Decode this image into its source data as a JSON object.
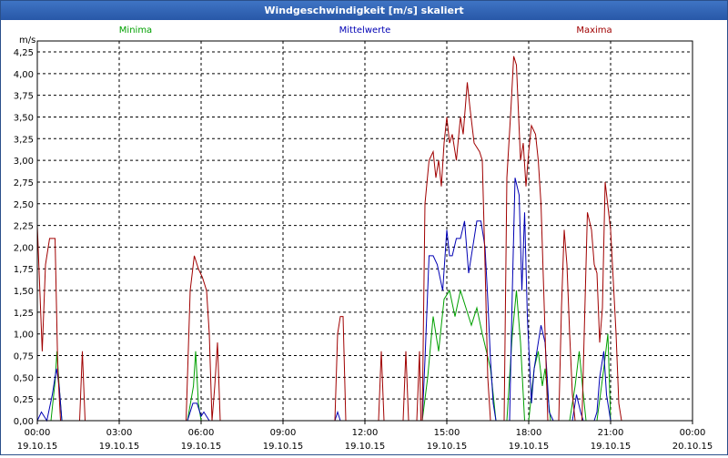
{
  "window": {
    "title": "Windgeschwindigkeit [m/s] skaliert"
  },
  "chart_data": {
    "type": "line",
    "ylabel": "m/s",
    "ylim": [
      0,
      4.25
    ],
    "yticks": [
      "0,00",
      "0,25",
      "0,50",
      "0,75",
      "1,00",
      "1,25",
      "1,50",
      "1,75",
      "2,00",
      "2,25",
      "2,50",
      "2,75",
      "3,00",
      "3,25",
      "3,50",
      "3,75",
      "4,00",
      "4,25"
    ],
    "xlim": [
      0,
      24
    ],
    "xticks": [
      {
        "time": "00:00",
        "date": "19.10.15"
      },
      {
        "time": "03:00",
        "date": "19.10.15"
      },
      {
        "time": "06:00",
        "date": "19.10.15"
      },
      {
        "time": "09:00",
        "date": "19.10.15"
      },
      {
        "time": "12:00",
        "date": "19.10.15"
      },
      {
        "time": "15:00",
        "date": "19.10.15"
      },
      {
        "time": "18:00",
        "date": "19.10.15"
      },
      {
        "time": "21:00",
        "date": "19.10.15"
      },
      {
        "time": "00:00",
        "date": "20.10.15"
      }
    ],
    "grid": true,
    "series": [
      {
        "name": "Minima",
        "color": "#00a000",
        "points": [
          [
            0,
            0
          ],
          [
            0.5,
            0
          ],
          [
            0.65,
            0.45
          ],
          [
            0.72,
            0.8
          ],
          [
            0.8,
            0.4
          ],
          [
            0.9,
            0
          ],
          [
            5.5,
            0
          ],
          [
            5.72,
            0.4
          ],
          [
            5.8,
            0.8
          ],
          [
            5.9,
            0.2
          ],
          [
            6.0,
            0
          ],
          [
            14.1,
            0
          ],
          [
            14.3,
            0.5
          ],
          [
            14.5,
            1.2
          ],
          [
            14.7,
            0.8
          ],
          [
            14.9,
            1.4
          ],
          [
            15.1,
            1.5
          ],
          [
            15.3,
            1.2
          ],
          [
            15.5,
            1.5
          ],
          [
            15.7,
            1.3
          ],
          [
            15.9,
            1.1
          ],
          [
            16.1,
            1.3
          ],
          [
            16.3,
            1.0
          ],
          [
            16.6,
            0.6
          ],
          [
            16.8,
            0
          ],
          [
            17.2,
            0
          ],
          [
            17.4,
            1.0
          ],
          [
            17.55,
            1.5
          ],
          [
            17.7,
            0.9
          ],
          [
            17.85,
            0
          ],
          [
            18.0,
            0
          ],
          [
            18.2,
            0.6
          ],
          [
            18.35,
            0.8
          ],
          [
            18.5,
            0.4
          ],
          [
            18.6,
            0.6
          ],
          [
            18.8,
            0
          ],
          [
            19.5,
            0
          ],
          [
            19.7,
            0.4
          ],
          [
            19.85,
            0.8
          ],
          [
            20.0,
            0.3
          ],
          [
            20.1,
            0
          ],
          [
            20.5,
            0
          ],
          [
            20.75,
            0.6
          ],
          [
            20.9,
            1.0
          ],
          [
            21.0,
            0
          ],
          [
            24,
            0
          ]
        ]
      },
      {
        "name": "Mittelwerte",
        "color": "#0000b4",
        "points": [
          [
            0,
            0
          ],
          [
            0.15,
            0.1
          ],
          [
            0.35,
            0
          ],
          [
            0.55,
            0.3
          ],
          [
            0.7,
            0.6
          ],
          [
            0.8,
            0.4
          ],
          [
            0.9,
            0
          ],
          [
            5.5,
            0
          ],
          [
            5.7,
            0.2
          ],
          [
            5.85,
            0.2
          ],
          [
            6.0,
            0.05
          ],
          [
            6.1,
            0.1
          ],
          [
            6.3,
            0
          ],
          [
            10.9,
            0
          ],
          [
            11.0,
            0.1
          ],
          [
            11.1,
            0
          ],
          [
            14.1,
            0
          ],
          [
            14.2,
            0.7
          ],
          [
            14.35,
            1.9
          ],
          [
            14.5,
            1.9
          ],
          [
            14.65,
            1.8
          ],
          [
            14.85,
            1.5
          ],
          [
            15.0,
            2.2
          ],
          [
            15.1,
            1.9
          ],
          [
            15.2,
            1.9
          ],
          [
            15.35,
            2.1
          ],
          [
            15.5,
            2.1
          ],
          [
            15.65,
            2.3
          ],
          [
            15.8,
            1.7
          ],
          [
            15.95,
            2.0
          ],
          [
            16.1,
            2.3
          ],
          [
            16.25,
            2.3
          ],
          [
            16.4,
            2.0
          ],
          [
            16.5,
            1.4
          ],
          [
            16.6,
            0.7
          ],
          [
            16.7,
            0.2
          ],
          [
            16.8,
            0
          ],
          [
            17.3,
            0
          ],
          [
            17.4,
            1.5
          ],
          [
            17.5,
            2.8
          ],
          [
            17.65,
            2.6
          ],
          [
            17.75,
            1.5
          ],
          [
            17.85,
            2.4
          ],
          [
            17.95,
            1.2
          ],
          [
            18.1,
            0.2
          ],
          [
            18.2,
            0.6
          ],
          [
            18.35,
            0.9
          ],
          [
            18.45,
            1.1
          ],
          [
            18.6,
            0.9
          ],
          [
            18.75,
            0.1
          ],
          [
            18.9,
            0
          ],
          [
            19.6,
            0
          ],
          [
            19.75,
            0.3
          ],
          [
            19.9,
            0.1
          ],
          [
            20.0,
            0
          ],
          [
            20.4,
            0
          ],
          [
            20.5,
            0.1
          ],
          [
            20.6,
            0.5
          ],
          [
            20.75,
            0.8
          ],
          [
            20.85,
            0.3
          ],
          [
            21.0,
            0
          ],
          [
            24,
            0
          ]
        ]
      },
      {
        "name": "Maxima",
        "color": "#a00000",
        "points": [
          [
            0,
            2.25
          ],
          [
            0.18,
            0.8
          ],
          [
            0.3,
            1.8
          ],
          [
            0.45,
            2.1
          ],
          [
            0.65,
            2.1
          ],
          [
            0.75,
            0.6
          ],
          [
            0.85,
            0
          ],
          [
            1.55,
            0
          ],
          [
            1.65,
            0.8
          ],
          [
            1.75,
            0
          ],
          [
            5.45,
            0
          ],
          [
            5.6,
            1.5
          ],
          [
            5.75,
            1.9
          ],
          [
            5.9,
            1.75
          ],
          [
            6.05,
            1.65
          ],
          [
            6.2,
            1.5
          ],
          [
            6.3,
            1.0
          ],
          [
            6.4,
            0
          ],
          [
            6.5,
            0.4
          ],
          [
            6.6,
            0.9
          ],
          [
            6.7,
            0
          ],
          [
            10.9,
            0
          ],
          [
            11.0,
            1.0
          ],
          [
            11.1,
            1.2
          ],
          [
            11.2,
            1.2
          ],
          [
            11.3,
            0
          ],
          [
            12.5,
            0
          ],
          [
            12.6,
            0.8
          ],
          [
            12.7,
            0
          ],
          [
            13.4,
            0
          ],
          [
            13.5,
            0.8
          ],
          [
            13.6,
            0
          ],
          [
            13.9,
            0
          ],
          [
            14.0,
            0.8
          ],
          [
            14.05,
            0
          ],
          [
            14.1,
            0
          ],
          [
            14.2,
            2.5
          ],
          [
            14.35,
            3.0
          ],
          [
            14.5,
            3.1
          ],
          [
            14.6,
            2.8
          ],
          [
            14.7,
            3.0
          ],
          [
            14.8,
            2.7
          ],
          [
            14.9,
            3.2
          ],
          [
            15.0,
            3.5
          ],
          [
            15.1,
            3.2
          ],
          [
            15.2,
            3.3
          ],
          [
            15.35,
            3.0
          ],
          [
            15.5,
            3.5
          ],
          [
            15.6,
            3.3
          ],
          [
            15.75,
            3.9
          ],
          [
            15.85,
            3.6
          ],
          [
            16.0,
            3.2
          ],
          [
            16.2,
            3.1
          ],
          [
            16.3,
            3.0
          ],
          [
            16.4,
            1.8
          ],
          [
            16.5,
            0.5
          ],
          [
            16.6,
            0
          ],
          [
            17.1,
            0
          ],
          [
            17.2,
            2.8
          ],
          [
            17.35,
            3.6
          ],
          [
            17.45,
            4.2
          ],
          [
            17.55,
            4.1
          ],
          [
            17.7,
            3.0
          ],
          [
            17.8,
            3.2
          ],
          [
            17.9,
            2.7
          ],
          [
            18.0,
            3.1
          ],
          [
            18.1,
            3.4
          ],
          [
            18.25,
            3.3
          ],
          [
            18.35,
            3.0
          ],
          [
            18.45,
            2.5
          ],
          [
            18.55,
            1.5
          ],
          [
            18.7,
            0
          ],
          [
            19.1,
            0
          ],
          [
            19.2,
            1.3
          ],
          [
            19.3,
            2.2
          ],
          [
            19.4,
            1.8
          ],
          [
            19.5,
            1.0
          ],
          [
            19.6,
            0.3
          ],
          [
            19.7,
            0
          ],
          [
            19.95,
            0
          ],
          [
            20.05,
            1.2
          ],
          [
            20.15,
            2.4
          ],
          [
            20.3,
            2.2
          ],
          [
            20.4,
            1.8
          ],
          [
            20.5,
            1.7
          ],
          [
            20.6,
            0.9
          ],
          [
            20.7,
            1.3
          ],
          [
            20.8,
            2.75
          ],
          [
            21.0,
            2.2
          ],
          [
            21.1,
            1.6
          ],
          [
            21.2,
            1.0
          ],
          [
            21.3,
            0.2
          ],
          [
            21.4,
            0
          ],
          [
            24,
            0
          ]
        ]
      }
    ]
  }
}
